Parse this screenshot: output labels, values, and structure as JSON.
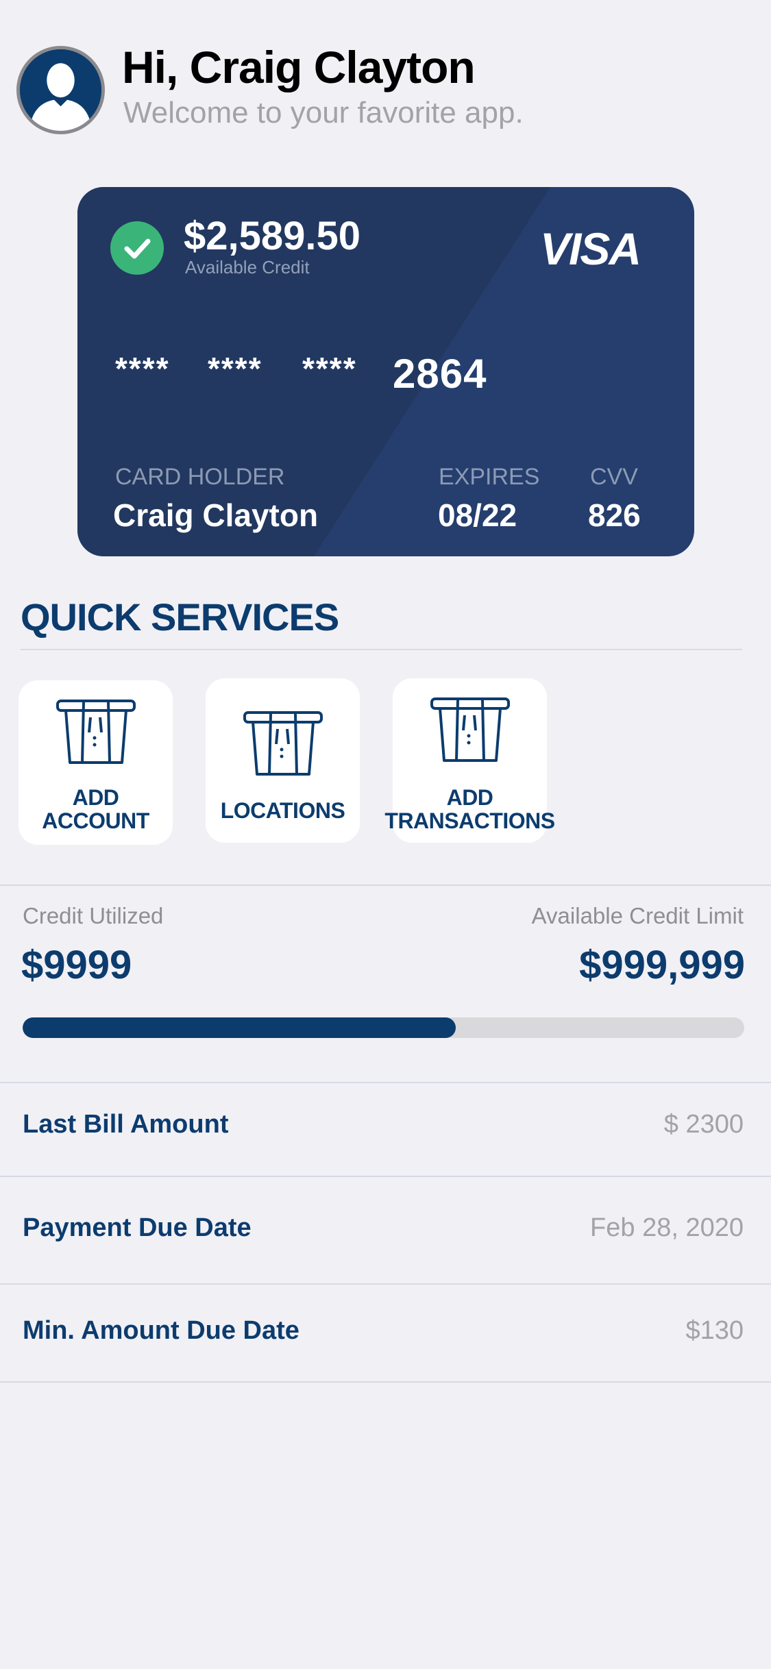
{
  "header": {
    "greeting": "Hi, Craig Clayton",
    "welcome": "Welcome to your favorite app."
  },
  "card": {
    "balance": "$2,589.50",
    "balance_label": "Available Credit",
    "brand": "VISA",
    "masked_groups": [
      "****",
      "****",
      "****"
    ],
    "last_four": "2864",
    "holder_label": "CARD HOLDER",
    "holder_name": "Craig Clayton",
    "expires_label": "EXPIRES",
    "expires_value": "08/22",
    "cvv_label": "CVV",
    "cvv_value": "826",
    "colors": {
      "card": "#253e6e",
      "check": "#3bb47a"
    }
  },
  "quick_services": {
    "title": "QUICK SERVICES",
    "tiles": [
      {
        "label_line1": "ADD",
        "label_line2": "ACCOUNT",
        "icon": "atm-card-icon"
      },
      {
        "label_line1": "",
        "label_line2": "LOCATIONS",
        "icon": "atm-card-icon"
      },
      {
        "label_line1": "ADD",
        "label_line2": "TRANSACTIONS",
        "icon": "atm-card-icon"
      }
    ]
  },
  "credit": {
    "utilized_label": "Credit Utilized",
    "utilized_value": "$9999",
    "limit_label": "Available Credit Limit",
    "limit_value": "$999,999",
    "progress_percent": 60
  },
  "details": [
    {
      "label": "Last Bill Amount",
      "value": "$ 2300"
    },
    {
      "label": "Payment Due Date",
      "value": "Feb 28, 2020"
    },
    {
      "label": "Min. Amount Due Date",
      "value": "$130"
    }
  ],
  "colors": {
    "primary": "#0c3c6e",
    "background": "#f1f0f5",
    "muted": "#a3a2a6"
  }
}
